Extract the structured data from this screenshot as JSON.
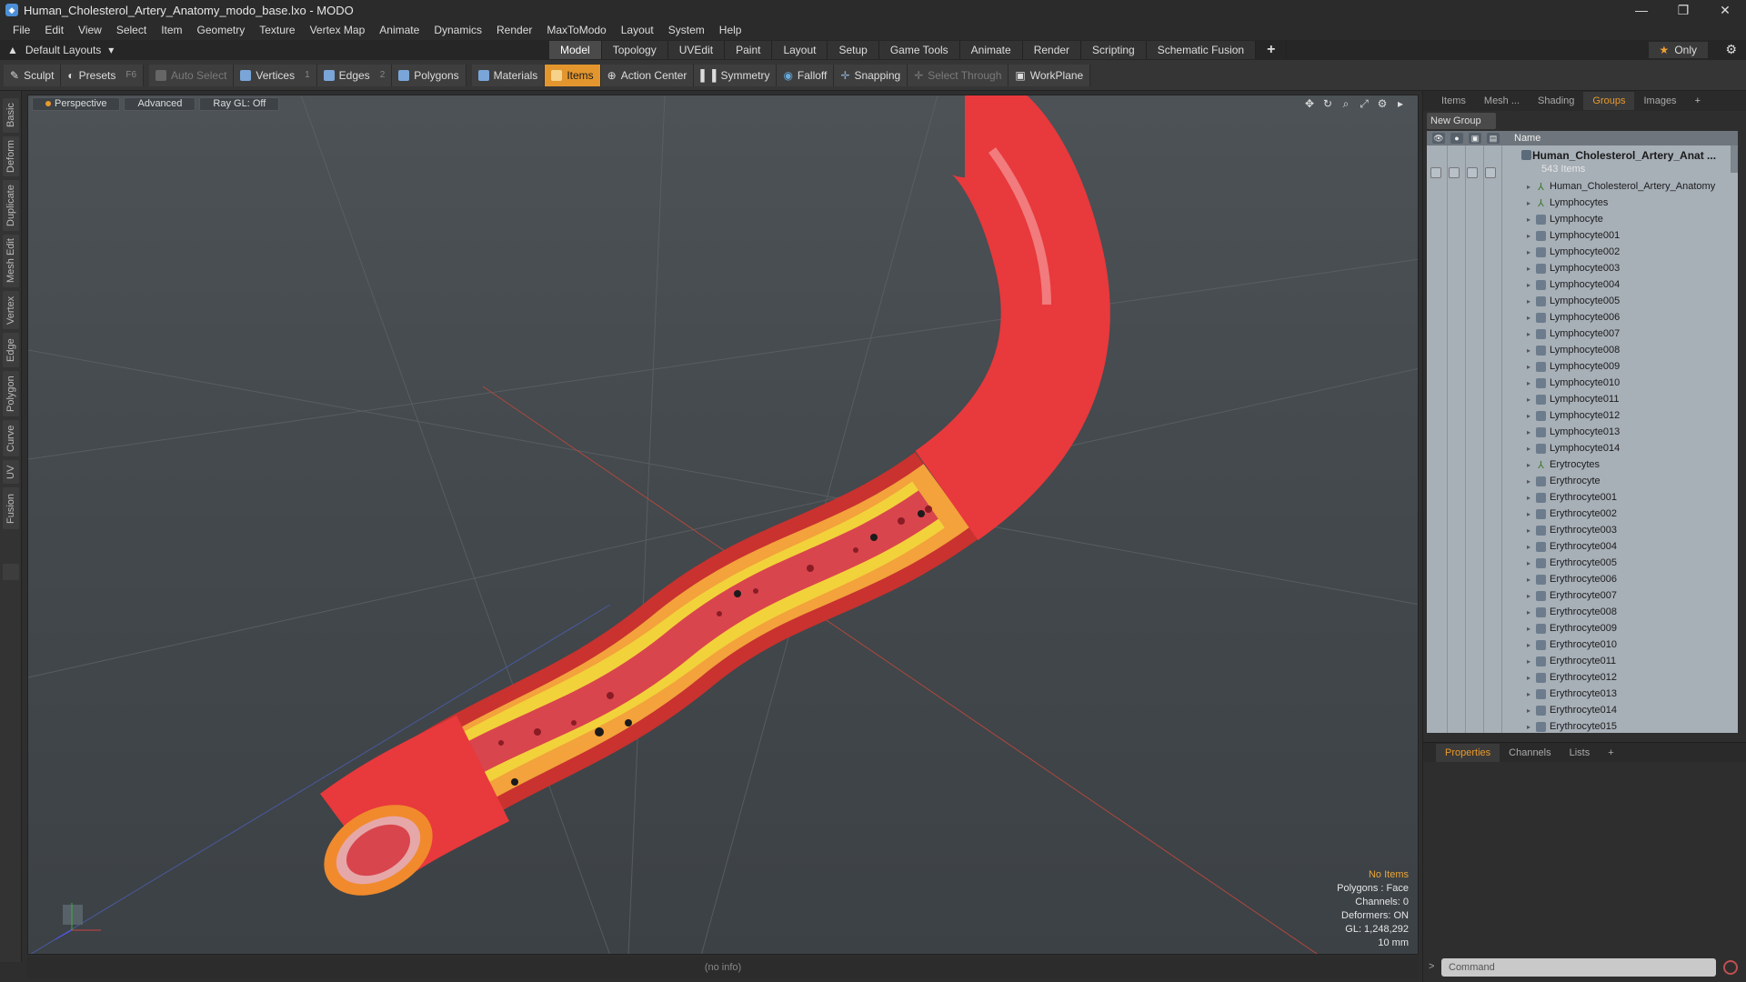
{
  "window": {
    "title": "Human_Cholesterol_Artery_Anatomy_modo_base.lxo - MODO"
  },
  "menu": [
    "File",
    "Edit",
    "View",
    "Select",
    "Item",
    "Geometry",
    "Texture",
    "Vertex Map",
    "Animate",
    "Dynamics",
    "Render",
    "MaxToModo",
    "Layout",
    "System",
    "Help"
  ],
  "layout": {
    "name": "Default Layouts",
    "only_label": "Only"
  },
  "mode_tabs": [
    "Model",
    "Topology",
    "UVEdit",
    "Paint",
    "Layout",
    "Setup",
    "Game Tools",
    "Animate",
    "Render",
    "Scripting",
    "Schematic Fusion"
  ],
  "active_mode": "Model",
  "toolbar": {
    "sculpt": "Sculpt",
    "presets": "Presets",
    "presets_key": "F6",
    "auto_select": "Auto Select",
    "vertices": "Vertices",
    "vertices_key": "1",
    "edges": "Edges",
    "edges_key": "2",
    "polygons": "Polygons",
    "materials": "Materials",
    "items": "Items",
    "action_center": "Action Center",
    "symmetry": "Symmetry",
    "falloff": "Falloff",
    "snapping": "Snapping",
    "select_through": "Select Through",
    "workplane": "WorkPlane"
  },
  "left_tabs": [
    "Basic",
    "Deform",
    "Duplicate",
    "Mesh Edit",
    "Vertex",
    "Edge",
    "Polygon",
    "Curve",
    "UV",
    "Fusion"
  ],
  "viewport": {
    "view": "Perspective",
    "shading": "Advanced",
    "raygl": "Ray GL: Off",
    "info": {
      "selection": "No Items",
      "polygons": "Polygons : Face",
      "channels": "Channels: 0",
      "deformers": "Deformers: ON",
      "gl": "GL: 1,248,292",
      "scale": "10 mm"
    },
    "status": "(no info)"
  },
  "right_panel": {
    "tabs": [
      "Items",
      "Mesh ...",
      "Shading",
      "Groups",
      "Images"
    ],
    "active_tab": "Groups",
    "new_group": "New Group",
    "column_name": "Name",
    "root": {
      "name": "Human_Cholesterol_Artery_Anat ...",
      "count": "543 Items"
    },
    "items": [
      {
        "name": "Human_Cholesterol_Artery_Anatomy",
        "type": "locator"
      },
      {
        "name": "Lymphocytes",
        "type": "locator"
      },
      {
        "name": "Lymphocyte",
        "type": "mesh"
      },
      {
        "name": "Lymphocyte001",
        "type": "mesh"
      },
      {
        "name": "Lymphocyte002",
        "type": "mesh"
      },
      {
        "name": "Lymphocyte003",
        "type": "mesh"
      },
      {
        "name": "Lymphocyte004",
        "type": "mesh"
      },
      {
        "name": "Lymphocyte005",
        "type": "mesh"
      },
      {
        "name": "Lymphocyte006",
        "type": "mesh"
      },
      {
        "name": "Lymphocyte007",
        "type": "mesh"
      },
      {
        "name": "Lymphocyte008",
        "type": "mesh"
      },
      {
        "name": "Lymphocyte009",
        "type": "mesh"
      },
      {
        "name": "Lymphocyte010",
        "type": "mesh"
      },
      {
        "name": "Lymphocyte011",
        "type": "mesh"
      },
      {
        "name": "Lymphocyte012",
        "type": "mesh"
      },
      {
        "name": "Lymphocyte013",
        "type": "mesh"
      },
      {
        "name": "Lymphocyte014",
        "type": "mesh"
      },
      {
        "name": "Erytrocytes",
        "type": "locator"
      },
      {
        "name": "Erythrocyte",
        "type": "mesh"
      },
      {
        "name": "Erythrocyte001",
        "type": "mesh"
      },
      {
        "name": "Erythrocyte002",
        "type": "mesh"
      },
      {
        "name": "Erythrocyte003",
        "type": "mesh"
      },
      {
        "name": "Erythrocyte004",
        "type": "mesh"
      },
      {
        "name": "Erythrocyte005",
        "type": "mesh"
      },
      {
        "name": "Erythrocyte006",
        "type": "mesh"
      },
      {
        "name": "Erythrocyte007",
        "type": "mesh"
      },
      {
        "name": "Erythrocyte008",
        "type": "mesh"
      },
      {
        "name": "Erythrocyte009",
        "type": "mesh"
      },
      {
        "name": "Erythrocyte010",
        "type": "mesh"
      },
      {
        "name": "Erythrocyte011",
        "type": "mesh"
      },
      {
        "name": "Erythrocyte012",
        "type": "mesh"
      },
      {
        "name": "Erythrocyte013",
        "type": "mesh"
      },
      {
        "name": "Erythrocyte014",
        "type": "mesh"
      },
      {
        "name": "Erythrocyte015",
        "type": "mesh"
      }
    ],
    "bottom_tabs": [
      "Properties",
      "Channels",
      "Lists"
    ],
    "active_bottom_tab": "Properties",
    "command_placeholder": "Command"
  },
  "colors": {
    "accent": "#e3962e",
    "artery": "#e8393c",
    "plaque": "#f2d23a"
  }
}
